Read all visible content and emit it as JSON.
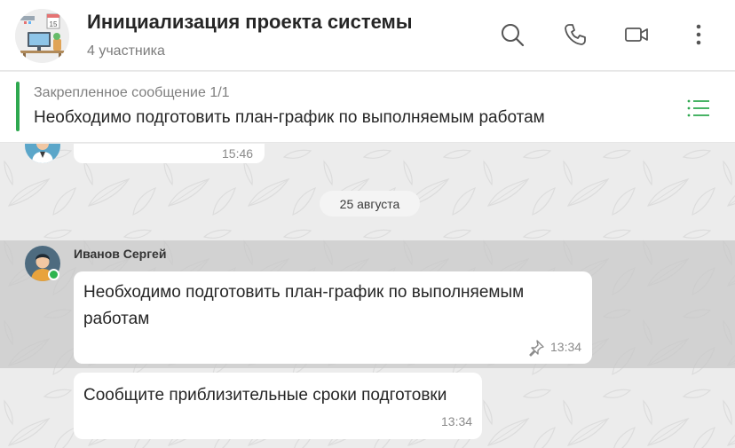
{
  "header": {
    "title": "Инициализация проекта системы",
    "subtitle": "4 участника",
    "group_avatar_badge": "15",
    "icons": [
      "search-icon",
      "phone-icon",
      "video-icon",
      "more-icon"
    ]
  },
  "pinned": {
    "label": "Закрепленное сообщение 1/1",
    "text": "Необходимо подготовить план-график по выполняемым работам",
    "accent_color": "#2ea84f",
    "list_icon": "list-icon"
  },
  "chat": {
    "previous_message_time": "15:46",
    "date_separator": "25 августа",
    "sender": {
      "name": "Иванов Сергей",
      "online": true,
      "online_color": "#2eb44f"
    },
    "messages": [
      {
        "text_line1": "Необходимо подготовить план-график по выполняемым",
        "text_line2": "работам",
        "time": "13:34",
        "pinned": true
      },
      {
        "text_line1": "Сообщите приблизительные сроки подготовки",
        "time": "13:34",
        "pinned": false
      }
    ]
  }
}
